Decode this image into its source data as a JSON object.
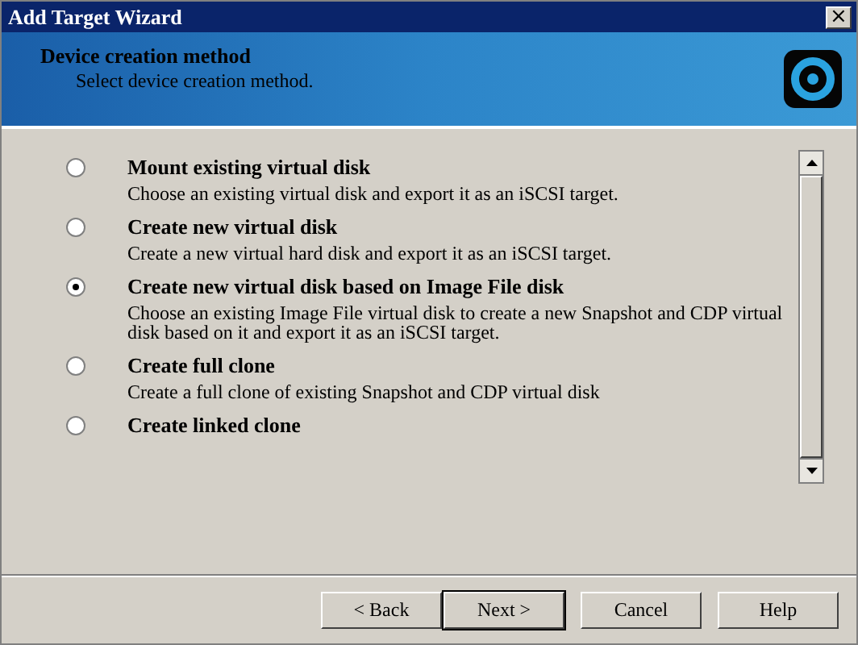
{
  "window": {
    "title": "Add Target Wizard",
    "close": "×"
  },
  "header": {
    "title": "Device creation method",
    "subtitle": "Select device creation method."
  },
  "options": [
    {
      "title": "Mount existing virtual disk",
      "description": "Choose an existing virtual disk and export it as an iSCSI target.",
      "selected": false
    },
    {
      "title": "Create new virtual disk",
      "description": "Create a new virtual hard disk and export it as an iSCSI target.",
      "selected": false
    },
    {
      "title": "Create new virtual disk based on Image File disk",
      "description": "Choose an existing Image File virtual disk to create a new Snapshot and CDP virtual disk based on it and export it as an iSCSI target.",
      "selected": true
    },
    {
      "title": "Create full clone",
      "description": "Create a full clone of existing Snapshot and CDP virtual disk",
      "selected": false
    },
    {
      "title": "Create linked clone",
      "selected": false
    }
  ],
  "buttons": [
    {
      "label": "< Back",
      "default": false
    },
    {
      "label": "Next >",
      "default": true
    },
    {
      "label": "Cancel",
      "default": false
    },
    {
      "label": "Help",
      "default": false
    }
  ]
}
